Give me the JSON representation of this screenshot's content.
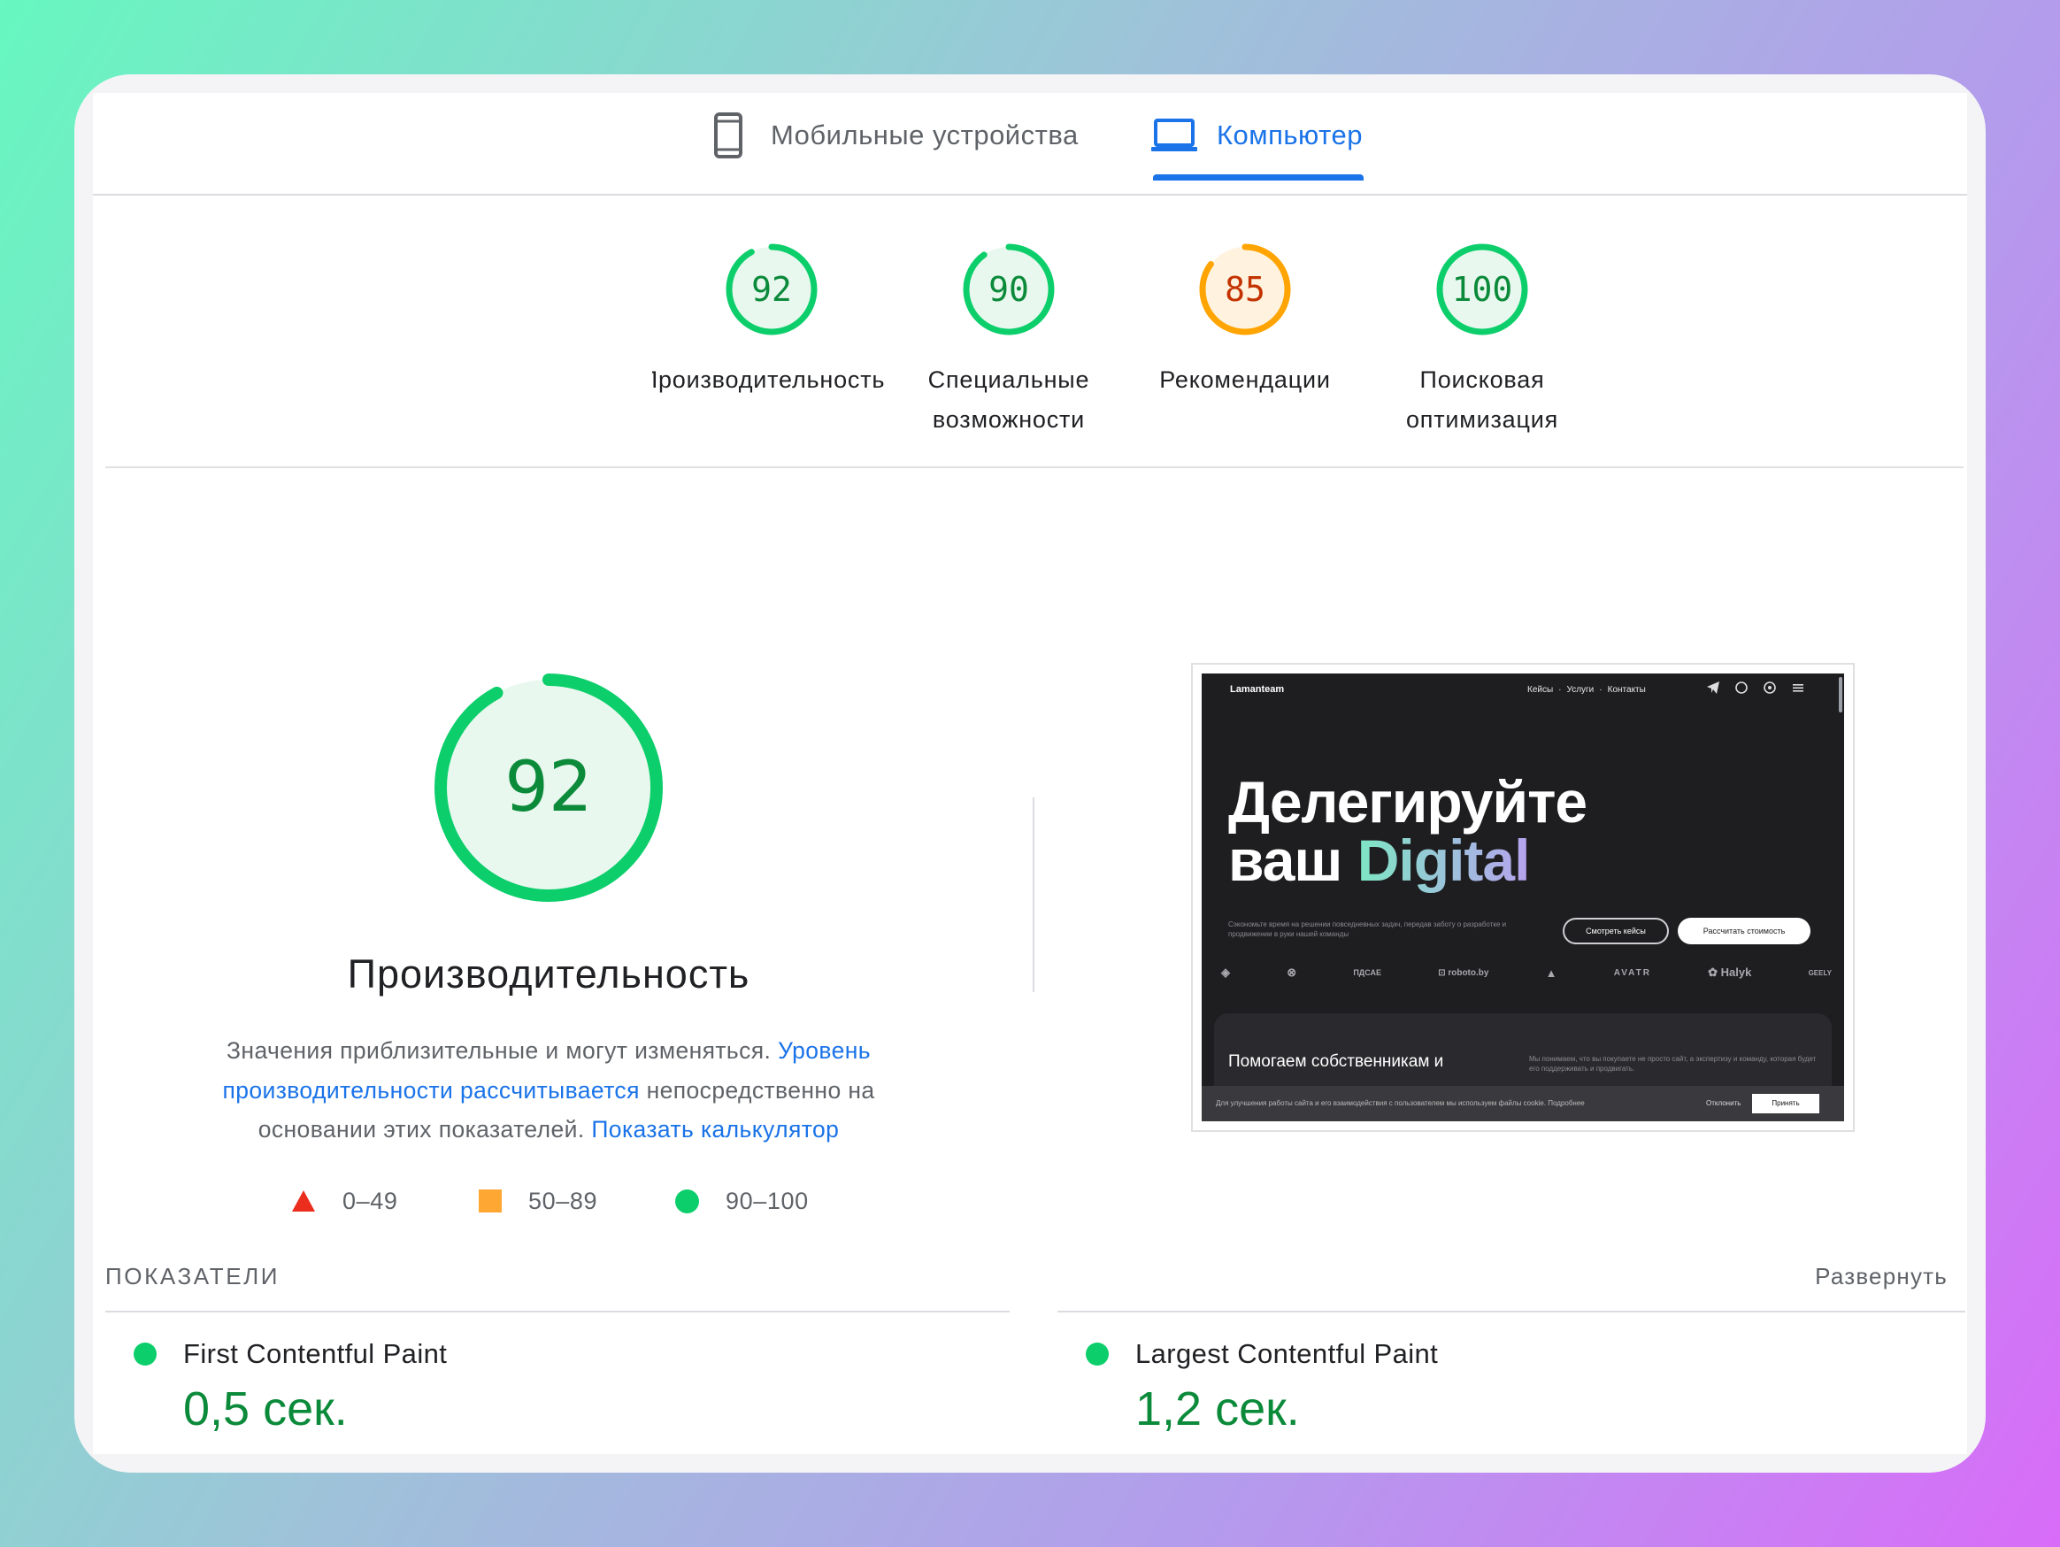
{
  "colors": {
    "pass": "#0cce6b",
    "pass_text": "#0b8a3a",
    "average": "#ffa400",
    "average_text": "#c33300",
    "fail": "#ff4e42",
    "link": "#1a73e8"
  },
  "tabs": {
    "mobile": {
      "label": "Мобильные устройства",
      "icon": "smartphone-icon",
      "active": false
    },
    "desktop": {
      "label": "Компьютер",
      "icon": "laptop-icon",
      "active": true
    }
  },
  "scores": [
    {
      "value": 92,
      "label_line1": "Производительность",
      "label_line2": "",
      "rating": "pass"
    },
    {
      "value": 90,
      "label_line1": "Специальные",
      "label_line2": "возможности",
      "rating": "pass"
    },
    {
      "value": 85,
      "label_line1": "Рекомендации",
      "label_line2": "",
      "rating": "average"
    },
    {
      "value": 100,
      "label_line1": "Поисковая",
      "label_line2": "оптимизация",
      "rating": "pass"
    }
  ],
  "performance": {
    "score": 92,
    "title": "Производительность",
    "desc_start": "Значения приблизительные и могут изменяться. ",
    "desc_link1": "Уровень производительности рассчитывается",
    "desc_middle": " непосредственно на основании этих показателей. ",
    "desc_link2": "Показать калькулятор"
  },
  "legend": {
    "fail": "0–49",
    "average": "50–89",
    "pass": "90–100"
  },
  "preview": {
    "brand": "Lamanteam",
    "nav": [
      "Кейсы",
      "·",
      "Услуги",
      "·",
      "Контакты"
    ],
    "headline_line1": "Делегируйте",
    "headline_line2a": "ваш ",
    "headline_line2b": "Digital",
    "subtitle": "Сэкономьте время на решении повседневных задач, передав заботу о разработке и продвижении в руки нашей команды",
    "button_secondary": "Смотреть кейсы",
    "button_primary": "Рассчитать стоимость",
    "logos": [
      "◈",
      "⊗",
      "ПДСАЕ",
      "⊡ roboto.by",
      "▲",
      "AVATR",
      "✿ Halyk",
      "GEELY"
    ],
    "card_heading": "Помогаем собственникам и маркетологам разгрузиться",
    "card_text": "Мы понимаем, что вы покупаете не просто сайт, а экспертизу и команду, которая будет его поддерживать и продвигать.",
    "cookie_text": "Для улучшения работы сайта и его взаимодействия с пользователем мы используем файлы cookie.  Подробнее",
    "cookie_decline": "Отклонить",
    "cookie_accept": "Принять"
  },
  "metrics": {
    "heading": "ПОКАЗАТЕЛИ",
    "expand_label": "Развернуть",
    "items": [
      {
        "name": "First Contentful Paint",
        "value": "0,5 сек.",
        "rating": "pass"
      },
      {
        "name": "Largest Contentful Paint",
        "value": "1,2 сек.",
        "rating": "pass"
      }
    ]
  }
}
